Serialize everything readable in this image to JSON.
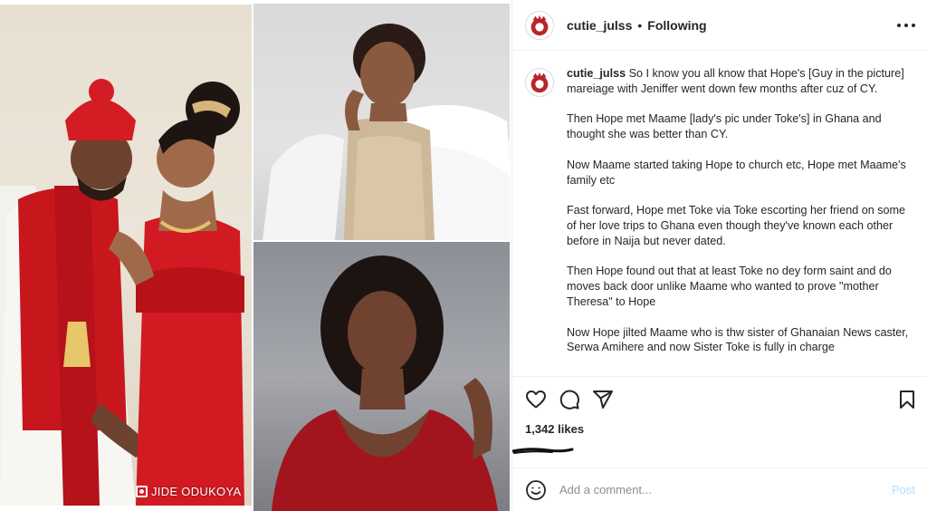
{
  "post": {
    "username": "cutie_julss",
    "separator": "•",
    "follow_status": "Following",
    "caption_username": "cutie_julss",
    "caption_paragraphs": [
      "So I know you all know that Hope's [Guy in the picture] mareiage with Jeniffer went down few months after cuz of CY.",
      "Then Hope met Maame [lady's pic under Toke's] in Ghana and thought she was better than CY.",
      "Now Maame started taking Hope to church etc, Hope met Maame's family etc",
      "Fast forward, Hope met Toke via Toke escorting her friend on some of her love trips to Ghana even though they've known each other before in Naija but never dated.",
      "Then Hope found out that at least Toke no dey form saint and do moves back door unlike Maame who wanted to prove \"mother Theresa\" to Hope",
      "Now Hope jilted Maame who is thw sister of Ghanaian News caster, Serwa Amihere and now Sister Toke is fully in charge"
    ],
    "likes": "1,342 likes"
  },
  "media": {
    "watermark": "JIDE ODUKOYA",
    "watermark_icon": "instagram-icon"
  },
  "comment": {
    "placeholder": "Add a comment...",
    "post_label": "Post"
  },
  "icons": {
    "more": "more-icon",
    "like": "heart-icon",
    "comment": "comment-icon",
    "share": "send-icon",
    "save": "bookmark-icon",
    "emoji": "emoji-icon"
  },
  "colors": {
    "text": "#262626",
    "muted": "#8e8e8e",
    "divider": "#efefef",
    "post_disabled": "#b3dbff",
    "attire_red": "#c8161d"
  }
}
